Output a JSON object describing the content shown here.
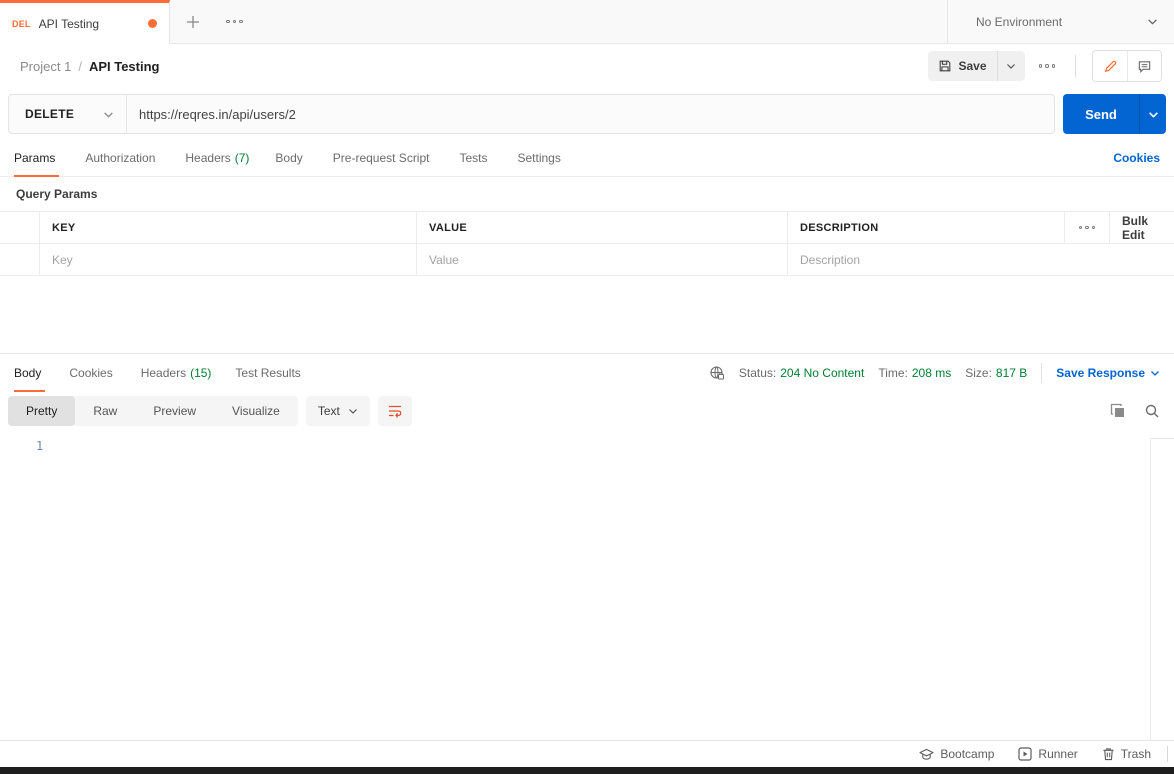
{
  "colors": {
    "accent": "#ff6c37",
    "blue": "#0265d2",
    "green": "#007f31"
  },
  "tabbar": {
    "method_abbrev": "DEL",
    "title": "API Testing",
    "environment": "No Environment"
  },
  "header": {
    "breadcrumb": {
      "project": "Project 1",
      "separator": "/",
      "current": "API Testing"
    },
    "save_label": "Save"
  },
  "request": {
    "method": "DELETE",
    "url": "https://reqres.in/api/users/2",
    "send_label": "Send",
    "cookies_link": "Cookies",
    "tabs": [
      {
        "label": "Params",
        "count": ""
      },
      {
        "label": "Authorization",
        "count": ""
      },
      {
        "label": "Headers",
        "count": "(7)"
      },
      {
        "label": "Body",
        "count": ""
      },
      {
        "label": "Pre-request Script",
        "count": ""
      },
      {
        "label": "Tests",
        "count": ""
      },
      {
        "label": "Settings",
        "count": ""
      }
    ]
  },
  "query_params": {
    "title": "Query Params",
    "columns": {
      "key": "KEY",
      "value": "VALUE",
      "description": "DESCRIPTION"
    },
    "bulk_edit_label": "Bulk Edit",
    "row_placeholders": {
      "key": "Key",
      "value": "Value",
      "description": "Description"
    }
  },
  "response": {
    "tabs": [
      {
        "label": "Body",
        "count": ""
      },
      {
        "label": "Cookies",
        "count": ""
      },
      {
        "label": "Headers",
        "count": "(15)"
      },
      {
        "label": "Test Results",
        "count": ""
      }
    ],
    "status_label": "Status:",
    "status_value": "204 No Content",
    "time_label": "Time:",
    "time_value": "208 ms",
    "size_label": "Size:",
    "size_value": "817 B",
    "save_response_label": "Save Response",
    "view_modes": [
      "Pretty",
      "Raw",
      "Preview",
      "Visualize"
    ],
    "format_selector": "Text",
    "editor_line_number": "1"
  },
  "footer": {
    "items": [
      {
        "label": "Bootcamp"
      },
      {
        "label": "Runner"
      },
      {
        "label": "Trash"
      }
    ]
  }
}
